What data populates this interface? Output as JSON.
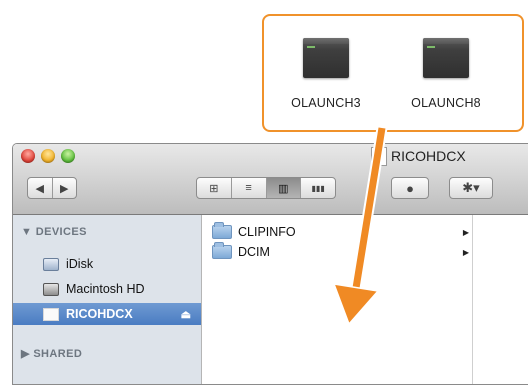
{
  "callout": {
    "files": [
      {
        "name": "OLAUNCH3",
        "icon": "executable-icon"
      },
      {
        "name": "OLAUNCH8",
        "icon": "executable-icon"
      }
    ]
  },
  "window": {
    "title": "RICOHDCX",
    "toolbar": {
      "back_glyph": "◀",
      "forward_glyph": "▶",
      "view_icons": "⊞",
      "view_list": "≡",
      "view_columns": "▥",
      "view_coverflow": "▮▮▮",
      "quicklook_glyph": "●",
      "action_glyph": "✱▾"
    },
    "sidebar": {
      "devices_header": "▼ DEVICES",
      "shared_header": "▶ SHARED",
      "items": [
        {
          "label": "iDisk",
          "icon": "idisk-icon"
        },
        {
          "label": "Macintosh HD",
          "icon": "hard-drive-icon"
        },
        {
          "label": "RICOHDCX",
          "icon": "memory-card-icon",
          "selected": true,
          "eject": "⏏"
        }
      ]
    },
    "content": {
      "folders": [
        {
          "name": "CLIPINFO",
          "arrow": "▶"
        },
        {
          "name": "DCIM",
          "arrow": "▶"
        }
      ]
    }
  },
  "colors": {
    "callout_border": "#f0922b",
    "arrow": "#f08a24",
    "selection": "#4a7cc2"
  }
}
